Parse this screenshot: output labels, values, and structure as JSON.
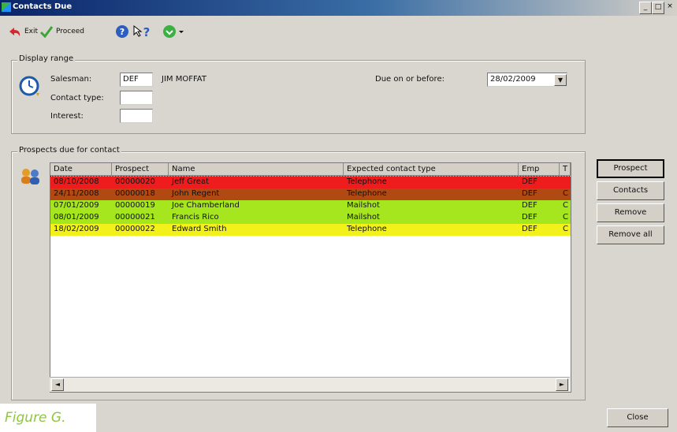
{
  "window": {
    "title": "Contacts Due",
    "min_glyph": "_",
    "max_glyph": "□",
    "close_glyph": "×"
  },
  "toolbar": {
    "exit_label": "Exit",
    "proceed_label": "Proceed"
  },
  "display_range": {
    "legend": "Display range",
    "salesman_label": "Salesman:",
    "salesman_value": "DEF",
    "salesman_name": "JIM MOFFAT",
    "contact_type_label": "Contact type:",
    "contact_type_value": "",
    "interest_label": "Interest:",
    "interest_value": "",
    "due_label": "Due on or before:",
    "due_value": "28/02/2009"
  },
  "prospects": {
    "legend": "Prospects due for contact",
    "columns": [
      "Date",
      "Prospect",
      "Name",
      "Expected contact type",
      "Emp",
      "T"
    ],
    "rows": [
      {
        "date": "08/10/2008",
        "prospect": "00000020",
        "name": "Jeff Great",
        "type": "Telephone",
        "emp": "DEF",
        "t": "",
        "bg": "#ee1c1c"
      },
      {
        "date": "24/11/2008",
        "prospect": "00000018",
        "name": "John Regent",
        "type": "Telephone",
        "emp": "DEF",
        "t": "C",
        "bg": "#b04a12"
      },
      {
        "date": "07/01/2009",
        "prospect": "00000019",
        "name": "Joe Chamberland",
        "type": "Mailshot",
        "emp": "DEF",
        "t": "C",
        "bg": "#a6e61e"
      },
      {
        "date": "08/01/2009",
        "prospect": "00000021",
        "name": "Francis Rico",
        "type": "Mailshot",
        "emp": "DEF",
        "t": "C",
        "bg": "#a6e61e"
      },
      {
        "date": "18/02/2009",
        "prospect": "00000022",
        "name": "Edward Smith",
        "type": "Telephone",
        "emp": "DEF",
        "t": "C",
        "bg": "#f2f21a"
      }
    ]
  },
  "side_buttons": {
    "prospect": "Prospect",
    "contacts": "Contacts",
    "remove": "Remove",
    "remove_all": "Remove all"
  },
  "close_label": "Close",
  "caption": "Figure G.",
  "scroll": {
    "left_glyph": "◄",
    "right_glyph": "►"
  }
}
